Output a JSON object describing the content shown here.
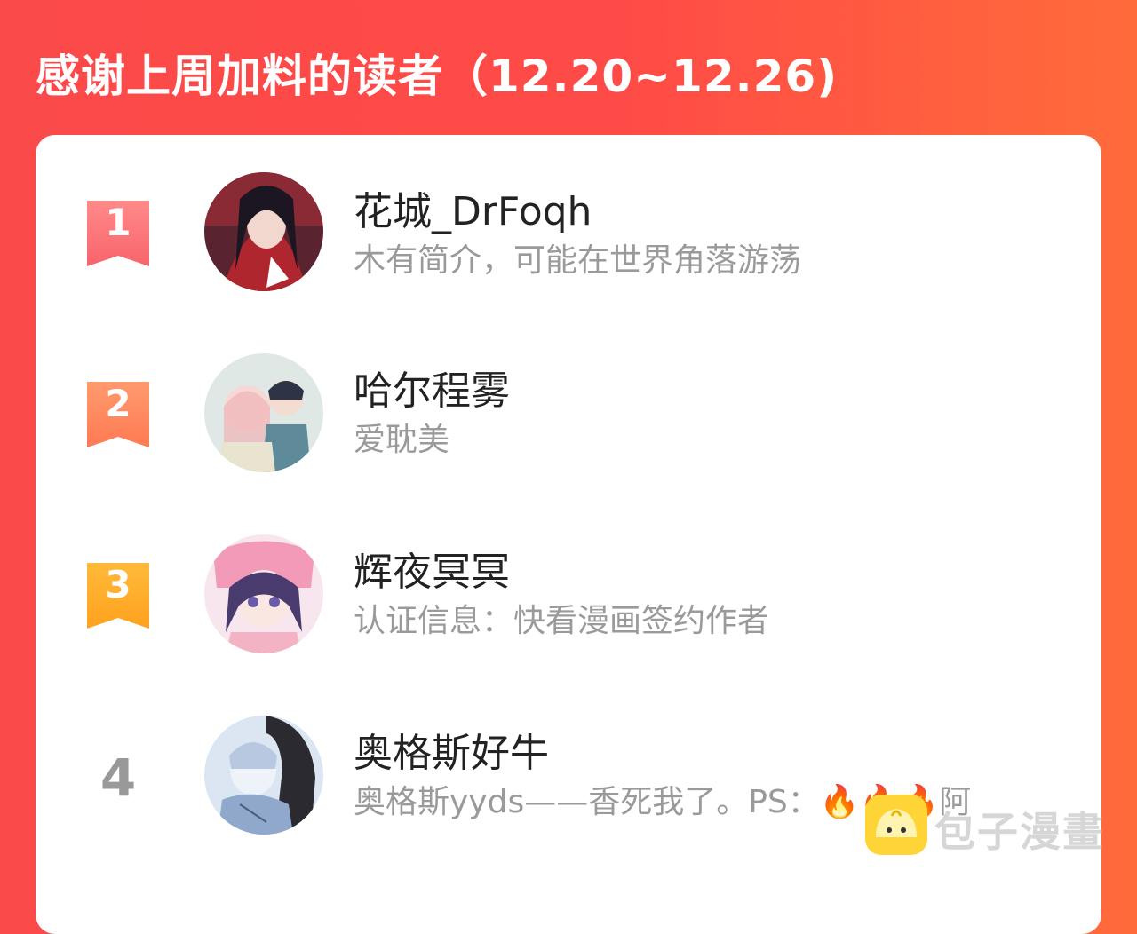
{
  "header": {
    "title": "感谢上周加料的读者（12.20~12.26)"
  },
  "readers": [
    {
      "rank": "1",
      "name": "花城_DrFoqh",
      "bio": "木有简介，可能在世界角落游荡",
      "badge_color": "#f8646b",
      "avatar_icon": "avatar-red-robed-character"
    },
    {
      "rank": "2",
      "name": "哈尔程雾",
      "bio": "爱耽美",
      "badge_color": "#ff7a52",
      "avatar_icon": "avatar-chibi-pair"
    },
    {
      "rank": "3",
      "name": "辉夜冥冥",
      "bio": "认证信息：快看漫画签约作者",
      "badge_color": "#ffa11e",
      "avatar_icon": "avatar-pink-hair-girl"
    },
    {
      "rank": "4",
      "name": "奥格斯好牛",
      "bio": "奥格斯yyds——香死我了。PS：🔥🔥🔥阿",
      "avatar_icon": "avatar-sketch-pair"
    }
  ],
  "watermark": {
    "text": "包子漫畫",
    "icon": "bun-mascot-icon"
  },
  "colors": {
    "background": "#fb4a4a",
    "card": "#ffffff",
    "name_text": "#222222",
    "bio_text": "#9a9a9a"
  }
}
